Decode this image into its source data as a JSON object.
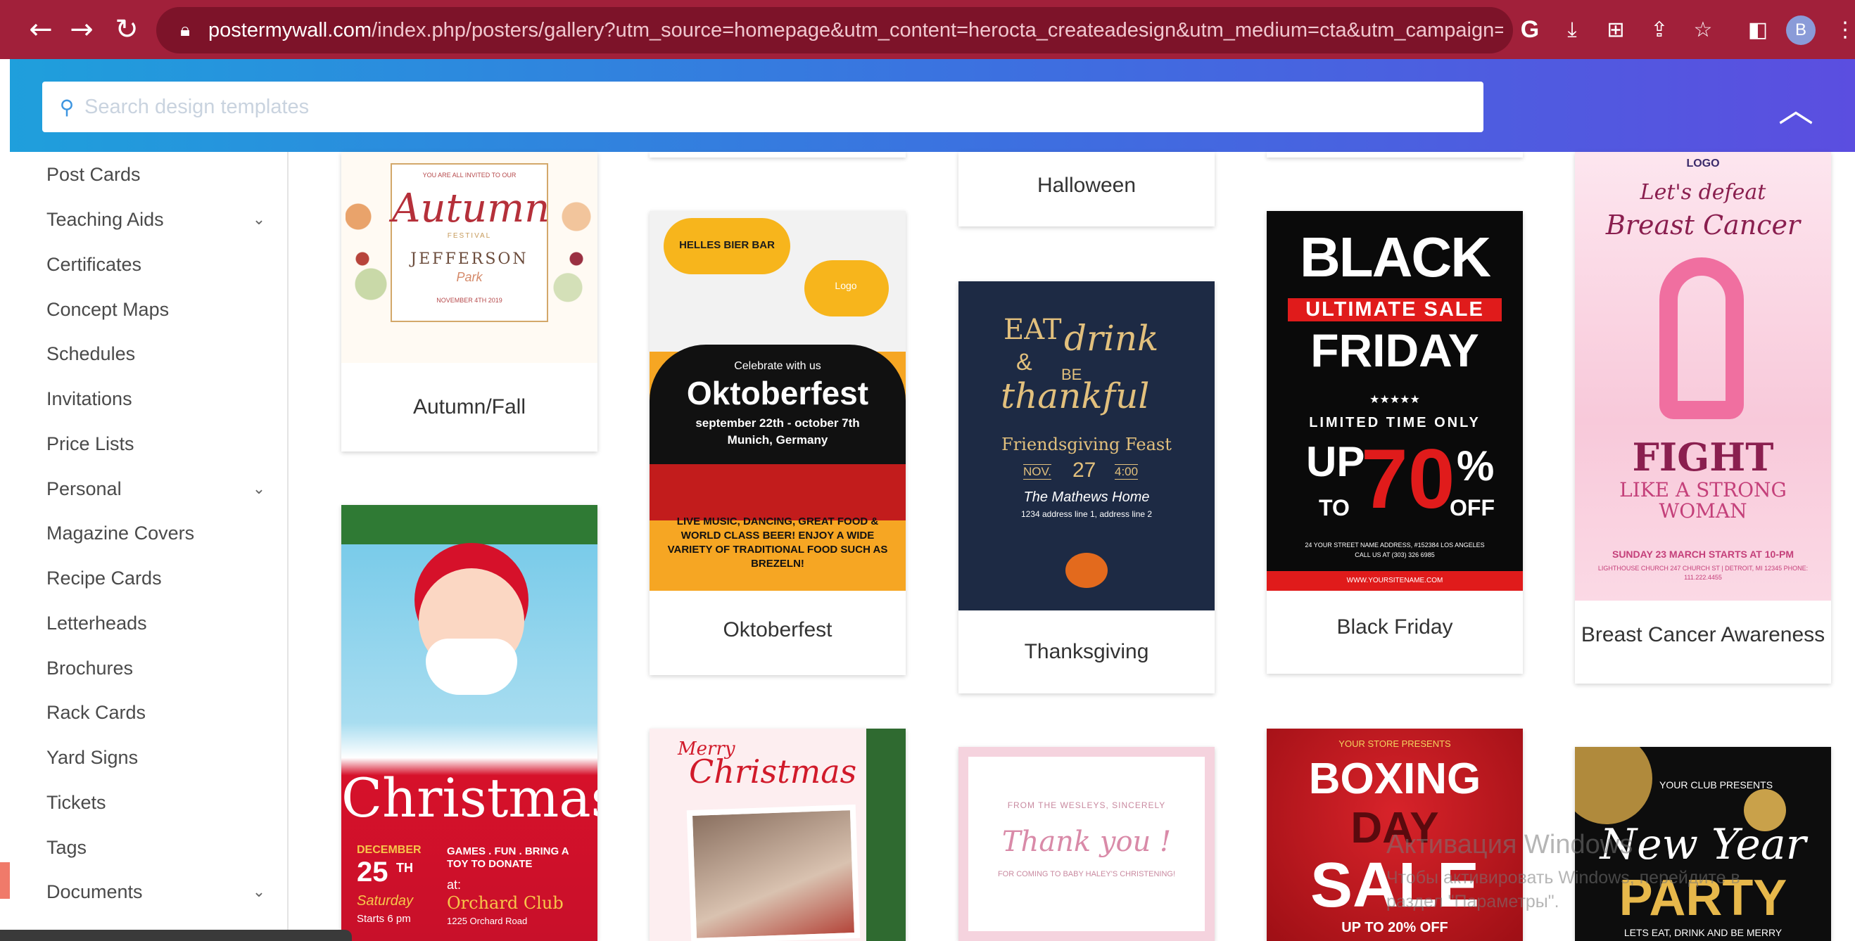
{
  "browser": {
    "url_host": "postermywall.com",
    "url_path": "/index.php/posters/gallery?utm_source=homepage&utm_content=herocta_createadesign&utm_medium=cta&utm_campaign=home...",
    "avatar_letter": "B",
    "colors": {
      "chrome": "#a1203a",
      "omnibox": "#7d1329"
    }
  },
  "search": {
    "placeholder": "Search design templates"
  },
  "sidebar": {
    "items": [
      {
        "label": "Post Cards",
        "expandable": false
      },
      {
        "label": "Teaching Aids",
        "expandable": true
      },
      {
        "label": "Certificates",
        "expandable": false
      },
      {
        "label": "Concept Maps",
        "expandable": false
      },
      {
        "label": "Schedules",
        "expandable": false
      },
      {
        "label": "Invitations",
        "expandable": false
      },
      {
        "label": "Price Lists",
        "expandable": false
      },
      {
        "label": "Personal",
        "expandable": true
      },
      {
        "label": "Magazine Covers",
        "expandable": false
      },
      {
        "label": "Recipe Cards",
        "expandable": false
      },
      {
        "label": "Letterheads",
        "expandable": false
      },
      {
        "label": "Brochures",
        "expandable": false
      },
      {
        "label": "Rack Cards",
        "expandable": false
      },
      {
        "label": "Yard Signs",
        "expandable": false
      },
      {
        "label": "Tickets",
        "expandable": false
      },
      {
        "label": "Tags",
        "expandable": false
      },
      {
        "label": "Documents",
        "expandable": true
      }
    ]
  },
  "gallery": {
    "categories": {
      "autumn": "Autumn/Fall",
      "oktoberfest": "Oktoberfest",
      "halloween": "Halloween",
      "thanksgiving": "Thanksgiving",
      "black_friday": "Black Friday",
      "breast_cancer": "Breast Cancer Awareness"
    },
    "posters": {
      "autumn": {
        "line1": "YOU ARE ALL INVITED TO OUR",
        "title": "Autumn",
        "sub": "FESTIVAL",
        "venue": "JEFFERSON",
        "venue2": "Park",
        "date": "NOVEMBER 4TH 2019"
      },
      "oktoberfest": {
        "bar": "HELLES BIER BAR",
        "logo": "Logo",
        "celebrate": "Celebrate with us",
        "title": "Oktoberfest",
        "dates": "september 22th - october 7th",
        "place": "Munich, Germany",
        "body": "LIVE MUSIC, DANCING, GREAT FOOD & WORLD CLASS BEER! ENJOY A WIDE VARIETY OF TRADITIONAL FOOD SUCH AS BREZELN!"
      },
      "thanksgiving": {
        "eat": "EAT",
        "drink": "drink",
        "amp": "&",
        "be": "BE",
        "thankful": "thankful",
        "event": "Friendsgiving Feast",
        "month": "NOV.",
        "day": "27",
        "time": "4:00",
        "host": "The Mathews Home",
        "address": "1234 address line 1, address line 2"
      },
      "black_friday": {
        "black": "BLACK",
        "banner": "ULTIMATE SALE",
        "friday": "FRIDAY",
        "stars": "★★★★★",
        "limited": "LIMITED TIME ONLY",
        "up": "UP",
        "to": "TO",
        "percent": "70",
        "pct_sign": "%",
        "off": "OFF",
        "addr": "24 YOUR STREET NAME ADDRESS, #152384 LOS ANGELES",
        "call": "CALL US AT (303) 326 6985",
        "site": "WWW.YOURSITENAME.COM"
      },
      "breast_cancer": {
        "logo": "LOGO",
        "line1": "Let's defeat",
        "line2": "Breast Cancer",
        "fight": "FIGHT",
        "like": "LIKE A STRONG",
        "woman": "WOMAN",
        "date": "SUNDAY 23 MARCH STARTS AT 10-PM",
        "addr": "LIGHTHOUSE CHURCH 247 CHURCH ST | DETROIT, MI 12345 PHONE: 111.222.4455"
      },
      "christmas": {
        "title": "Christmas",
        "month": "DECEMBER",
        "day": "25",
        "th": "TH",
        "weekday": "Saturday",
        "starts": "Starts 6 pm",
        "games": "GAMES . FUN . BRING A TOY TO DONATE",
        "at": "at:",
        "club": "Orchard Club",
        "street": "1225 Orchard Road"
      },
      "merry": {
        "merry": "Merry",
        "title": "Christmas"
      },
      "thankyou": {
        "from": "FROM THE WESLEYS, SINCERELY",
        "title": "Thank you !",
        "for": "FOR COMING TO BABY HALEY'S CHRISTENING!"
      },
      "boxing": {
        "presents": "YOUR STORE PRESENTS",
        "boxing": "BOXING",
        "day": "DAY",
        "sale": "SALE",
        "upto": "UP TO 20% OFF"
      },
      "newyear": {
        "presents": "YOUR CLUB PRESENTS",
        "new": "New Year",
        "party": "PARTY",
        "tagline": "LETS EAT, DRINK AND BE MERRY"
      }
    }
  },
  "watermark": {
    "title": "Активация Windows",
    "line1": "Чтобы активировать Windows, перейдите в",
    "line2": "раздел \"Параметры\"."
  }
}
